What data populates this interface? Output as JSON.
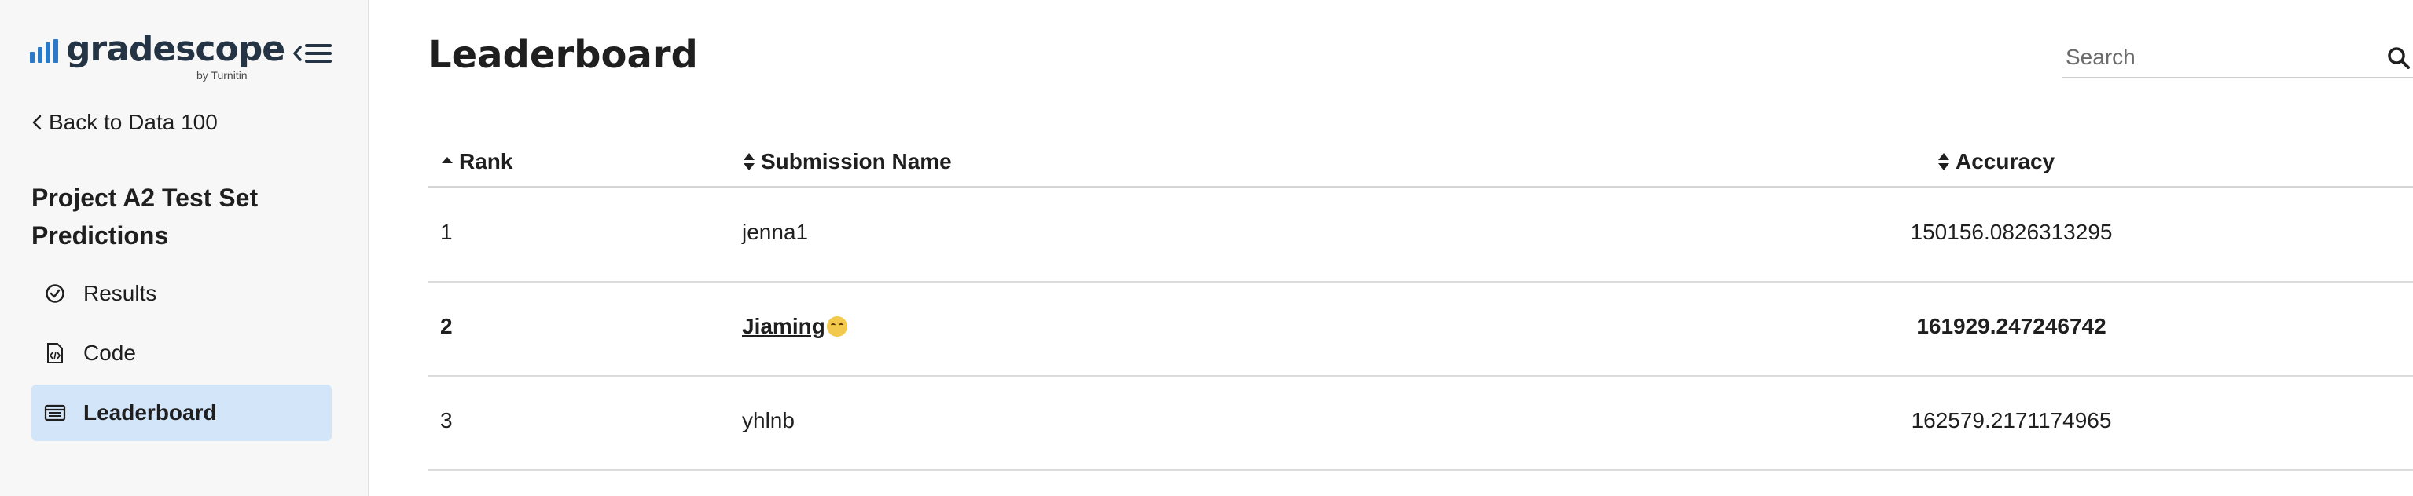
{
  "brand": {
    "name": "gradescope",
    "sub": "by Turnitin",
    "color": "#2a7ac9"
  },
  "sidebar": {
    "back_label": "Back to Data 100",
    "assignment_title": "Project A2 Test Set Predictions",
    "items": [
      {
        "label": "Results",
        "icon": "check-circle-icon",
        "active": false
      },
      {
        "label": "Code",
        "icon": "code-file-icon",
        "active": false
      },
      {
        "label": "Leaderboard",
        "icon": "leaderboard-icon",
        "active": true
      }
    ],
    "active_bg": "#d3e6f9"
  },
  "main": {
    "title": "Leaderboard",
    "search": {
      "placeholder": "Search",
      "value": ""
    },
    "table": {
      "columns": [
        {
          "label": "Rank",
          "sort": "ascending"
        },
        {
          "label": "Submission Name",
          "sort": "none"
        },
        {
          "label": "Accuracy",
          "sort": "none"
        }
      ],
      "rows": [
        {
          "rank": "1",
          "name": "jenna1",
          "accuracy": "150156.0826313295",
          "highlight": false
        },
        {
          "rank": "2",
          "name": "Jiaming",
          "emoji": "🥹",
          "accuracy": "161929.247246742",
          "highlight": true
        },
        {
          "rank": "3",
          "name": "yhlnb",
          "accuracy": "162579.2171174965",
          "highlight": false
        }
      ]
    }
  }
}
